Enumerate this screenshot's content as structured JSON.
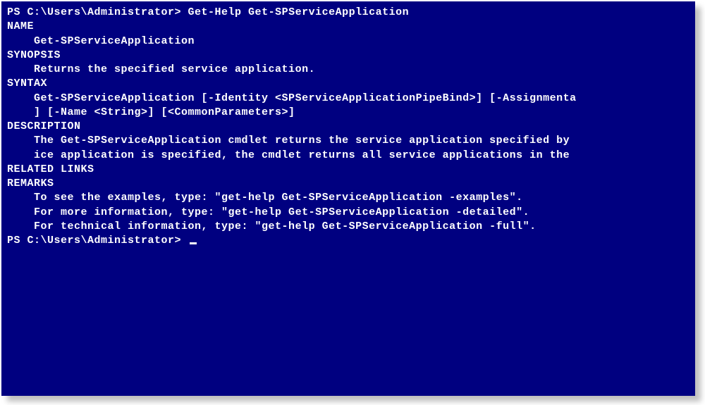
{
  "terminal": {
    "prompt1": "PS C:\\Users\\Administrator> ",
    "command": "Get-Help Get-SPServiceApplication",
    "blank": "",
    "sections": {
      "name_heading": "NAME",
      "name_value": "    Get-SPServiceApplication",
      "synopsis_heading": "SYNOPSIS",
      "synopsis_value": "    Returns the specified service application.",
      "syntax_heading": "SYNTAX",
      "syntax_line1": "    Get-SPServiceApplication [-Identity <SPServiceApplicationPipeBind>] [-Assignmenta",
      "syntax_line2": "    ] [-Name <String>] [<CommonParameters>]",
      "description_heading": "DESCRIPTION",
      "description_line1": "    The Get-SPServiceApplication cmdlet returns the service application specified by",
      "description_line2": "    ice application is specified, the cmdlet returns all service applications in the",
      "related_heading": "RELATED LINKS",
      "remarks_heading": "REMARKS",
      "remarks_line1": "    To see the examples, type: \"get-help Get-SPServiceApplication -examples\".",
      "remarks_line2": "    For more information, type: \"get-help Get-SPServiceApplication -detailed\".",
      "remarks_line3": "    For technical information, type: \"get-help Get-SPServiceApplication -full\"."
    },
    "prompt2": "PS C:\\Users\\Administrator> "
  }
}
